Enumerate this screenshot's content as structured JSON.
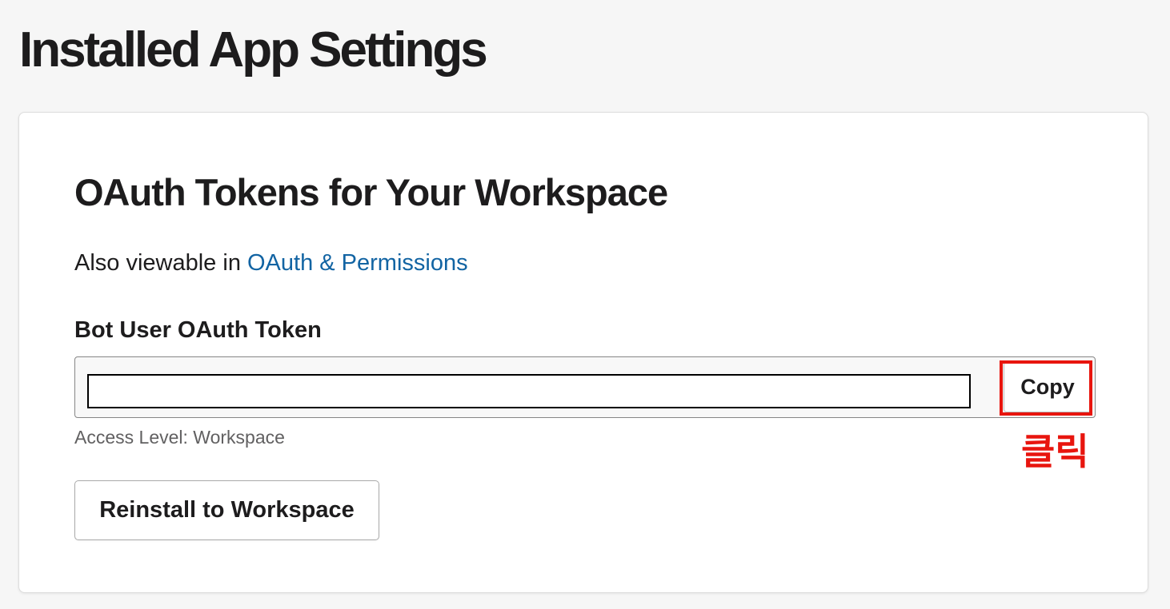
{
  "page": {
    "title": "Installed App Settings"
  },
  "oauth_section": {
    "title": "OAuth Tokens for Your Workspace",
    "also_viewable_prefix": "Also viewable in ",
    "also_viewable_link": "OAuth & Permissions",
    "token_label": "Bot User OAuth Token",
    "token_value": "",
    "copy_label": "Copy",
    "access_level": "Access Level: Workspace",
    "reinstall_label": "Reinstall to Workspace"
  },
  "annotation": {
    "text": "클릭",
    "color": "#e8150e"
  },
  "colors": {
    "background": "#f6f6f6",
    "link": "#1264a3",
    "text": "#1d1c1d",
    "muted": "#616061"
  }
}
